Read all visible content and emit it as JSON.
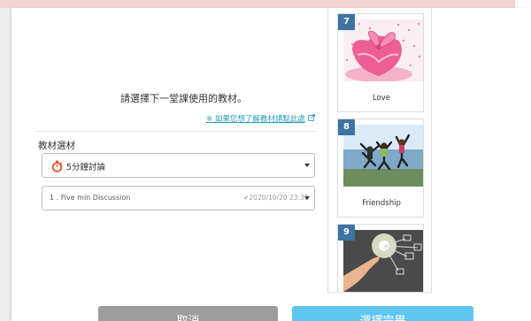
{
  "dialog": {
    "instruction": "請選擇下一堂課使用的教材。",
    "material_link": "※ 如果您想了解教材請點此處"
  },
  "materials": {
    "section_label": "教材選材",
    "category_select": {
      "value": "5分鐘討論"
    },
    "lesson_select": {
      "value": "1 . Five min Discussion",
      "date": "✔2020/10/20 23:31"
    }
  },
  "cards": [
    {
      "number": "7",
      "title": "Love"
    },
    {
      "number": "8",
      "title": "Friendship"
    },
    {
      "number": "9",
      "title": ""
    }
  ],
  "buttons": {
    "cancel": "取消",
    "confirm": "選擇完畢"
  },
  "colors": {
    "card_badge": "#3d73a3",
    "link": "#2a9bb8",
    "cancel_button": "#9d9d9d",
    "confirm_button": "#5ec7ef",
    "timer_icon": "#e8532b"
  },
  "icons": [
    "external-link-icon",
    "timer-icon",
    "chevron-down-icon"
  ]
}
